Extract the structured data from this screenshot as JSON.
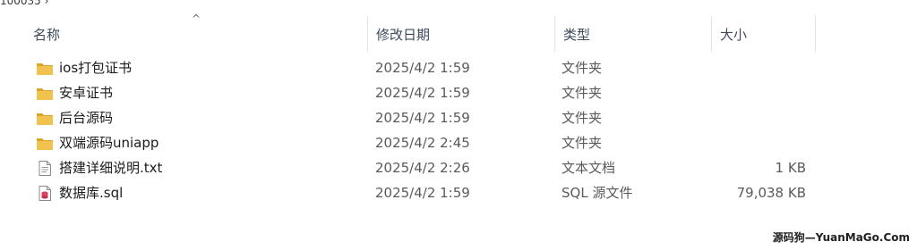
{
  "breadcrumb": {
    "text": "100035 ›"
  },
  "columns": {
    "name": "名称",
    "date": "修改日期",
    "type": "类型",
    "size": "大小"
  },
  "files": [
    {
      "name": "ios打包证书",
      "date": "2025/4/2 1:59",
      "type": "文件夹",
      "size": "",
      "icon": "folder-icon"
    },
    {
      "name": "安卓证书",
      "date": "2025/4/2 1:59",
      "type": "文件夹",
      "size": "",
      "icon": "folder-icon"
    },
    {
      "name": "后台源码",
      "date": "2025/4/2 1:59",
      "type": "文件夹",
      "size": "",
      "icon": "folder-icon"
    },
    {
      "name": "双端源码uniapp",
      "date": "2025/4/2 2:45",
      "type": "文件夹",
      "size": "",
      "icon": "folder-icon"
    },
    {
      "name": "搭建详细说明.txt",
      "date": "2025/4/2 2:26",
      "type": "文本文档",
      "size": "1 KB",
      "icon": "text-file-icon"
    },
    {
      "name": "数据库.sql",
      "date": "2025/4/2 1:59",
      "type": "SQL 源文件",
      "size": "79,038 KB",
      "icon": "sql-file-icon"
    }
  ],
  "watermark": "源码狗—YuanMaGo.Com",
  "colors": {
    "folder": "#f2c24f",
    "folder_dark": "#dca32b",
    "sql_accent": "#d9415c",
    "header_text": "#3d4a5c"
  }
}
